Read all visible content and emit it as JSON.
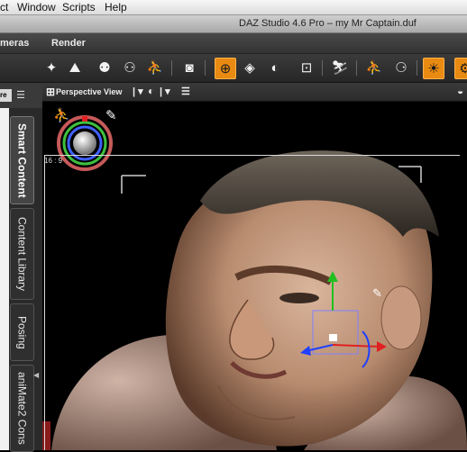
{
  "menubar": {
    "items": [
      "ct",
      "Window",
      "Scripts",
      "Help"
    ]
  },
  "window": {
    "title": "DAZ Studio 4.6 Pro – my Mr Captain.duf"
  },
  "app_menu": {
    "items": [
      "meras",
      "Render"
    ]
  },
  "left_panel": {
    "cut_tab": "re",
    "tabs": [
      {
        "label": "Smart Content",
        "selected": true
      },
      {
        "label": "Content Library",
        "selected": false
      },
      {
        "label": "Posing",
        "selected": false
      },
      {
        "label": "aniMate2 Cons",
        "selected": false
      }
    ]
  },
  "viewport": {
    "view_label": "Perspective View",
    "aspect_label": "16 : 9"
  },
  "colors": {
    "accent": "#e98a12",
    "toolbar_bg": "#2e2e2e",
    "axis_x": "#e02020",
    "axis_y": "#20c020",
    "axis_z": "#2040ff"
  }
}
